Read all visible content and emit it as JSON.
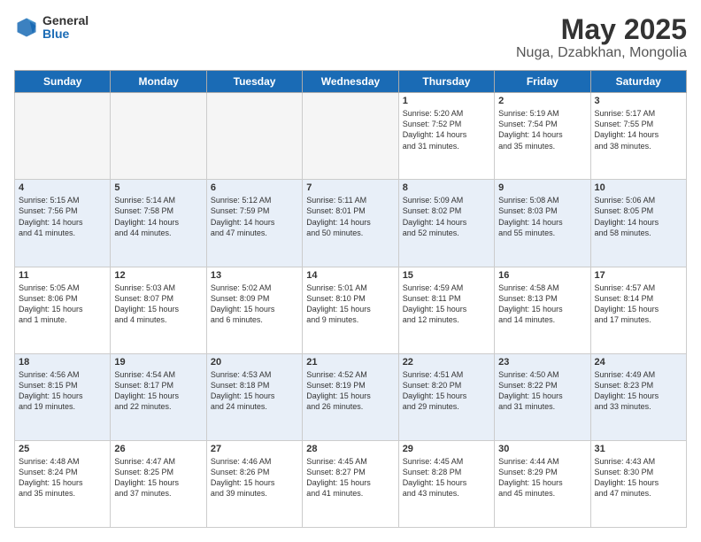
{
  "header": {
    "logo_general": "General",
    "logo_blue": "Blue",
    "title": "May 2025",
    "subtitle": "Nuga, Dzabkhan, Mongolia"
  },
  "days_of_week": [
    "Sunday",
    "Monday",
    "Tuesday",
    "Wednesday",
    "Thursday",
    "Friday",
    "Saturday"
  ],
  "weeks": [
    [
      {
        "day": "",
        "info": ""
      },
      {
        "day": "",
        "info": ""
      },
      {
        "day": "",
        "info": ""
      },
      {
        "day": "",
        "info": ""
      },
      {
        "day": "1",
        "info": "Sunrise: 5:20 AM\nSunset: 7:52 PM\nDaylight: 14 hours\nand 31 minutes."
      },
      {
        "day": "2",
        "info": "Sunrise: 5:19 AM\nSunset: 7:54 PM\nDaylight: 14 hours\nand 35 minutes."
      },
      {
        "day": "3",
        "info": "Sunrise: 5:17 AM\nSunset: 7:55 PM\nDaylight: 14 hours\nand 38 minutes."
      }
    ],
    [
      {
        "day": "4",
        "info": "Sunrise: 5:15 AM\nSunset: 7:56 PM\nDaylight: 14 hours\nand 41 minutes."
      },
      {
        "day": "5",
        "info": "Sunrise: 5:14 AM\nSunset: 7:58 PM\nDaylight: 14 hours\nand 44 minutes."
      },
      {
        "day": "6",
        "info": "Sunrise: 5:12 AM\nSunset: 7:59 PM\nDaylight: 14 hours\nand 47 minutes."
      },
      {
        "day": "7",
        "info": "Sunrise: 5:11 AM\nSunset: 8:01 PM\nDaylight: 14 hours\nand 50 minutes."
      },
      {
        "day": "8",
        "info": "Sunrise: 5:09 AM\nSunset: 8:02 PM\nDaylight: 14 hours\nand 52 minutes."
      },
      {
        "day": "9",
        "info": "Sunrise: 5:08 AM\nSunset: 8:03 PM\nDaylight: 14 hours\nand 55 minutes."
      },
      {
        "day": "10",
        "info": "Sunrise: 5:06 AM\nSunset: 8:05 PM\nDaylight: 14 hours\nand 58 minutes."
      }
    ],
    [
      {
        "day": "11",
        "info": "Sunrise: 5:05 AM\nSunset: 8:06 PM\nDaylight: 15 hours\nand 1 minute."
      },
      {
        "day": "12",
        "info": "Sunrise: 5:03 AM\nSunset: 8:07 PM\nDaylight: 15 hours\nand 4 minutes."
      },
      {
        "day": "13",
        "info": "Sunrise: 5:02 AM\nSunset: 8:09 PM\nDaylight: 15 hours\nand 6 minutes."
      },
      {
        "day": "14",
        "info": "Sunrise: 5:01 AM\nSunset: 8:10 PM\nDaylight: 15 hours\nand 9 minutes."
      },
      {
        "day": "15",
        "info": "Sunrise: 4:59 AM\nSunset: 8:11 PM\nDaylight: 15 hours\nand 12 minutes."
      },
      {
        "day": "16",
        "info": "Sunrise: 4:58 AM\nSunset: 8:13 PM\nDaylight: 15 hours\nand 14 minutes."
      },
      {
        "day": "17",
        "info": "Sunrise: 4:57 AM\nSunset: 8:14 PM\nDaylight: 15 hours\nand 17 minutes."
      }
    ],
    [
      {
        "day": "18",
        "info": "Sunrise: 4:56 AM\nSunset: 8:15 PM\nDaylight: 15 hours\nand 19 minutes."
      },
      {
        "day": "19",
        "info": "Sunrise: 4:54 AM\nSunset: 8:17 PM\nDaylight: 15 hours\nand 22 minutes."
      },
      {
        "day": "20",
        "info": "Sunrise: 4:53 AM\nSunset: 8:18 PM\nDaylight: 15 hours\nand 24 minutes."
      },
      {
        "day": "21",
        "info": "Sunrise: 4:52 AM\nSunset: 8:19 PM\nDaylight: 15 hours\nand 26 minutes."
      },
      {
        "day": "22",
        "info": "Sunrise: 4:51 AM\nSunset: 8:20 PM\nDaylight: 15 hours\nand 29 minutes."
      },
      {
        "day": "23",
        "info": "Sunrise: 4:50 AM\nSunset: 8:22 PM\nDaylight: 15 hours\nand 31 minutes."
      },
      {
        "day": "24",
        "info": "Sunrise: 4:49 AM\nSunset: 8:23 PM\nDaylight: 15 hours\nand 33 minutes."
      }
    ],
    [
      {
        "day": "25",
        "info": "Sunrise: 4:48 AM\nSunset: 8:24 PM\nDaylight: 15 hours\nand 35 minutes."
      },
      {
        "day": "26",
        "info": "Sunrise: 4:47 AM\nSunset: 8:25 PM\nDaylight: 15 hours\nand 37 minutes."
      },
      {
        "day": "27",
        "info": "Sunrise: 4:46 AM\nSunset: 8:26 PM\nDaylight: 15 hours\nand 39 minutes."
      },
      {
        "day": "28",
        "info": "Sunrise: 4:45 AM\nSunset: 8:27 PM\nDaylight: 15 hours\nand 41 minutes."
      },
      {
        "day": "29",
        "info": "Sunrise: 4:45 AM\nSunset: 8:28 PM\nDaylight: 15 hours\nand 43 minutes."
      },
      {
        "day": "30",
        "info": "Sunrise: 4:44 AM\nSunset: 8:29 PM\nDaylight: 15 hours\nand 45 minutes."
      },
      {
        "day": "31",
        "info": "Sunrise: 4:43 AM\nSunset: 8:30 PM\nDaylight: 15 hours\nand 47 minutes."
      }
    ]
  ],
  "alt_row_indices": [
    1,
    3
  ],
  "colors": {
    "header_bg": "#1a6bb5",
    "alt_row": "#e8eff8",
    "empty_cell": "#f5f5f5"
  }
}
